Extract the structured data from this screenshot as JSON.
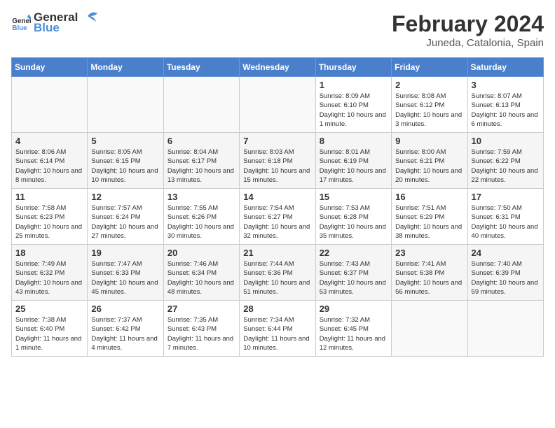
{
  "header": {
    "logo_text_general": "General",
    "logo_text_blue": "Blue",
    "month_year": "February 2024",
    "location": "Juneda, Catalonia, Spain"
  },
  "days_of_week": [
    "Sunday",
    "Monday",
    "Tuesday",
    "Wednesday",
    "Thursday",
    "Friday",
    "Saturday"
  ],
  "weeks": [
    [
      {
        "day": "",
        "info": ""
      },
      {
        "day": "",
        "info": ""
      },
      {
        "day": "",
        "info": ""
      },
      {
        "day": "",
        "info": ""
      },
      {
        "day": "1",
        "info": "Sunrise: 8:09 AM\nSunset: 6:10 PM\nDaylight: 10 hours\nand 1 minute."
      },
      {
        "day": "2",
        "info": "Sunrise: 8:08 AM\nSunset: 6:12 PM\nDaylight: 10 hours\nand 3 minutes."
      },
      {
        "day": "3",
        "info": "Sunrise: 8:07 AM\nSunset: 6:13 PM\nDaylight: 10 hours\nand 6 minutes."
      }
    ],
    [
      {
        "day": "4",
        "info": "Sunrise: 8:06 AM\nSunset: 6:14 PM\nDaylight: 10 hours\nand 8 minutes."
      },
      {
        "day": "5",
        "info": "Sunrise: 8:05 AM\nSunset: 6:15 PM\nDaylight: 10 hours\nand 10 minutes."
      },
      {
        "day": "6",
        "info": "Sunrise: 8:04 AM\nSunset: 6:17 PM\nDaylight: 10 hours\nand 13 minutes."
      },
      {
        "day": "7",
        "info": "Sunrise: 8:03 AM\nSunset: 6:18 PM\nDaylight: 10 hours\nand 15 minutes."
      },
      {
        "day": "8",
        "info": "Sunrise: 8:01 AM\nSunset: 6:19 PM\nDaylight: 10 hours\nand 17 minutes."
      },
      {
        "day": "9",
        "info": "Sunrise: 8:00 AM\nSunset: 6:21 PM\nDaylight: 10 hours\nand 20 minutes."
      },
      {
        "day": "10",
        "info": "Sunrise: 7:59 AM\nSunset: 6:22 PM\nDaylight: 10 hours\nand 22 minutes."
      }
    ],
    [
      {
        "day": "11",
        "info": "Sunrise: 7:58 AM\nSunset: 6:23 PM\nDaylight: 10 hours\nand 25 minutes."
      },
      {
        "day": "12",
        "info": "Sunrise: 7:57 AM\nSunset: 6:24 PM\nDaylight: 10 hours\nand 27 minutes."
      },
      {
        "day": "13",
        "info": "Sunrise: 7:55 AM\nSunset: 6:26 PM\nDaylight: 10 hours\nand 30 minutes."
      },
      {
        "day": "14",
        "info": "Sunrise: 7:54 AM\nSunset: 6:27 PM\nDaylight: 10 hours\nand 32 minutes."
      },
      {
        "day": "15",
        "info": "Sunrise: 7:53 AM\nSunset: 6:28 PM\nDaylight: 10 hours\nand 35 minutes."
      },
      {
        "day": "16",
        "info": "Sunrise: 7:51 AM\nSunset: 6:29 PM\nDaylight: 10 hours\nand 38 minutes."
      },
      {
        "day": "17",
        "info": "Sunrise: 7:50 AM\nSunset: 6:31 PM\nDaylight: 10 hours\nand 40 minutes."
      }
    ],
    [
      {
        "day": "18",
        "info": "Sunrise: 7:49 AM\nSunset: 6:32 PM\nDaylight: 10 hours\nand 43 minutes."
      },
      {
        "day": "19",
        "info": "Sunrise: 7:47 AM\nSunset: 6:33 PM\nDaylight: 10 hours\nand 45 minutes."
      },
      {
        "day": "20",
        "info": "Sunrise: 7:46 AM\nSunset: 6:34 PM\nDaylight: 10 hours\nand 48 minutes."
      },
      {
        "day": "21",
        "info": "Sunrise: 7:44 AM\nSunset: 6:36 PM\nDaylight: 10 hours\nand 51 minutes."
      },
      {
        "day": "22",
        "info": "Sunrise: 7:43 AM\nSunset: 6:37 PM\nDaylight: 10 hours\nand 53 minutes."
      },
      {
        "day": "23",
        "info": "Sunrise: 7:41 AM\nSunset: 6:38 PM\nDaylight: 10 hours\nand 56 minutes."
      },
      {
        "day": "24",
        "info": "Sunrise: 7:40 AM\nSunset: 6:39 PM\nDaylight: 10 hours\nand 59 minutes."
      }
    ],
    [
      {
        "day": "25",
        "info": "Sunrise: 7:38 AM\nSunset: 6:40 PM\nDaylight: 11 hours\nand 1 minute."
      },
      {
        "day": "26",
        "info": "Sunrise: 7:37 AM\nSunset: 6:42 PM\nDaylight: 11 hours\nand 4 minutes."
      },
      {
        "day": "27",
        "info": "Sunrise: 7:35 AM\nSunset: 6:43 PM\nDaylight: 11 hours\nand 7 minutes."
      },
      {
        "day": "28",
        "info": "Sunrise: 7:34 AM\nSunset: 6:44 PM\nDaylight: 11 hours\nand 10 minutes."
      },
      {
        "day": "29",
        "info": "Sunrise: 7:32 AM\nSunset: 6:45 PM\nDaylight: 11 hours\nand 12 minutes."
      },
      {
        "day": "",
        "info": ""
      },
      {
        "day": "",
        "info": ""
      }
    ]
  ]
}
